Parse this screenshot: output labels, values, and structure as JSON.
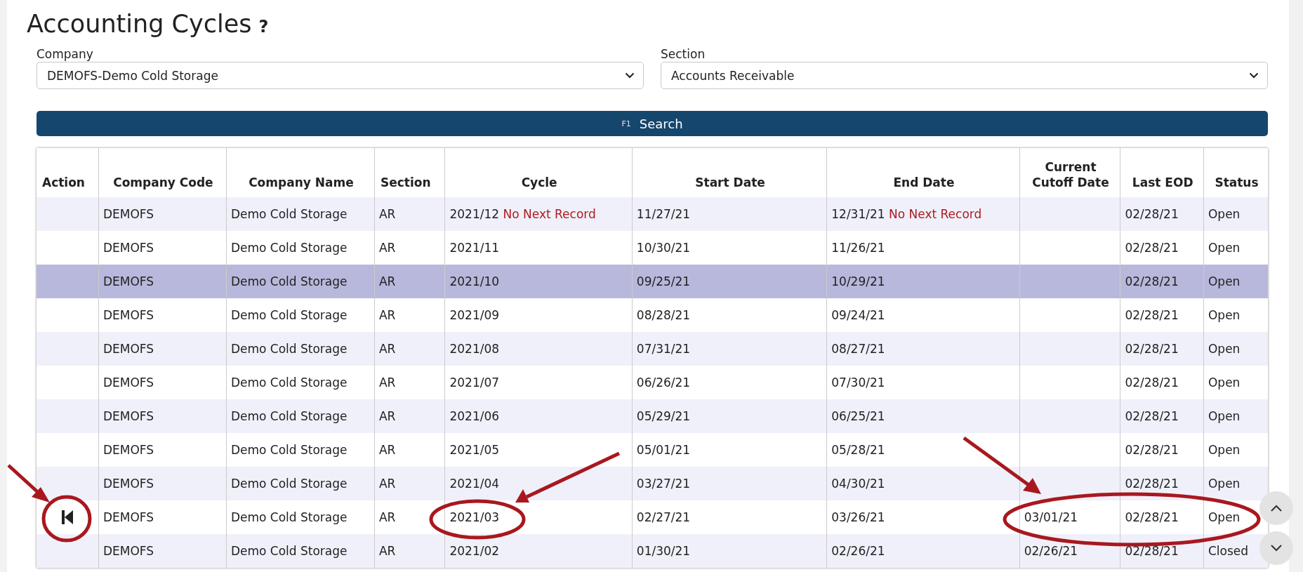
{
  "page": {
    "title": "Accounting Cycles",
    "help": "?"
  },
  "filters": [
    {
      "label": "Company",
      "value": "DEMOFS-Demo Cold Storage"
    },
    {
      "label": "Section",
      "value": "Accounts Receivable"
    }
  ],
  "search_button": {
    "shortcut": "F1",
    "label": "Search"
  },
  "table": {
    "columns": [
      "Action",
      "Company Code",
      "Company Name",
      "Section",
      "Cycle",
      "Start Date",
      "End Date",
      "Current Cutoff Date",
      "Last EOD",
      "Status"
    ],
    "rows": [
      {
        "selected": false,
        "has_action": false,
        "company_code": "DEMOFS",
        "company_name": "Demo Cold Storage",
        "section": "AR",
        "cycle": "2021/12",
        "cycle_note": "No Next Record",
        "start_date": "11/27/21",
        "end_date": "12/31/21",
        "end_note": "No Next Record",
        "cutoff_date": "",
        "last_eod": "02/28/21",
        "status": "Open"
      },
      {
        "selected": false,
        "has_action": false,
        "company_code": "DEMOFS",
        "company_name": "Demo Cold Storage",
        "section": "AR",
        "cycle": "2021/11",
        "start_date": "10/30/21",
        "end_date": "11/26/21",
        "last_eod": "02/28/21",
        "status": "Open"
      },
      {
        "selected": true,
        "has_action": false,
        "company_code": "DEMOFS",
        "company_name": "Demo Cold Storage",
        "section": "AR",
        "cycle": "2021/10",
        "start_date": "09/25/21",
        "end_date": "10/29/21",
        "last_eod": "02/28/21",
        "status": "Open"
      },
      {
        "selected": false,
        "has_action": false,
        "company_code": "DEMOFS",
        "company_name": "Demo Cold Storage",
        "section": "AR",
        "cycle": "2021/09",
        "start_date": "08/28/21",
        "end_date": "09/24/21",
        "last_eod": "02/28/21",
        "status": "Open"
      },
      {
        "selected": false,
        "has_action": false,
        "company_code": "DEMOFS",
        "company_name": "Demo Cold Storage",
        "section": "AR",
        "cycle": "2021/08",
        "start_date": "07/31/21",
        "end_date": "08/27/21",
        "last_eod": "02/28/21",
        "status": "Open"
      },
      {
        "selected": false,
        "has_action": false,
        "company_code": "DEMOFS",
        "company_name": "Demo Cold Storage",
        "section": "AR",
        "cycle": "2021/07",
        "start_date": "06/26/21",
        "end_date": "07/30/21",
        "last_eod": "02/28/21",
        "status": "Open"
      },
      {
        "selected": false,
        "has_action": false,
        "company_code": "DEMOFS",
        "company_name": "Demo Cold Storage",
        "section": "AR",
        "cycle": "2021/06",
        "start_date": "05/29/21",
        "end_date": "06/25/21",
        "last_eod": "02/28/21",
        "status": "Open"
      },
      {
        "selected": false,
        "has_action": false,
        "company_code": "DEMOFS",
        "company_name": "Demo Cold Storage",
        "section": "AR",
        "cycle": "2021/05",
        "start_date": "05/01/21",
        "end_date": "05/28/21",
        "last_eod": "02/28/21",
        "status": "Open"
      },
      {
        "selected": false,
        "has_action": false,
        "company_code": "DEMOFS",
        "company_name": "Demo Cold Storage",
        "section": "AR",
        "cycle": "2021/04",
        "start_date": "03/27/21",
        "end_date": "04/30/21",
        "last_eod": "02/28/21",
        "status": "Open"
      },
      {
        "selected": false,
        "has_action": true,
        "company_code": "DEMOFS",
        "company_name": "Demo Cold Storage",
        "section": "AR",
        "cycle": "2021/03",
        "start_date": "02/27/21",
        "end_date": "03/26/21",
        "cutoff_date": "03/01/21",
        "last_eod": "02/28/21",
        "status": "Open"
      },
      {
        "selected": false,
        "has_action": false,
        "company_code": "DEMOFS",
        "company_name": "Demo Cold Storage",
        "section": "AR",
        "cycle": "2021/02",
        "start_date": "01/30/21",
        "end_date": "02/26/21",
        "cutoff_date": "02/26/21",
        "last_eod": "02/28/21",
        "status": "Closed"
      }
    ]
  }
}
